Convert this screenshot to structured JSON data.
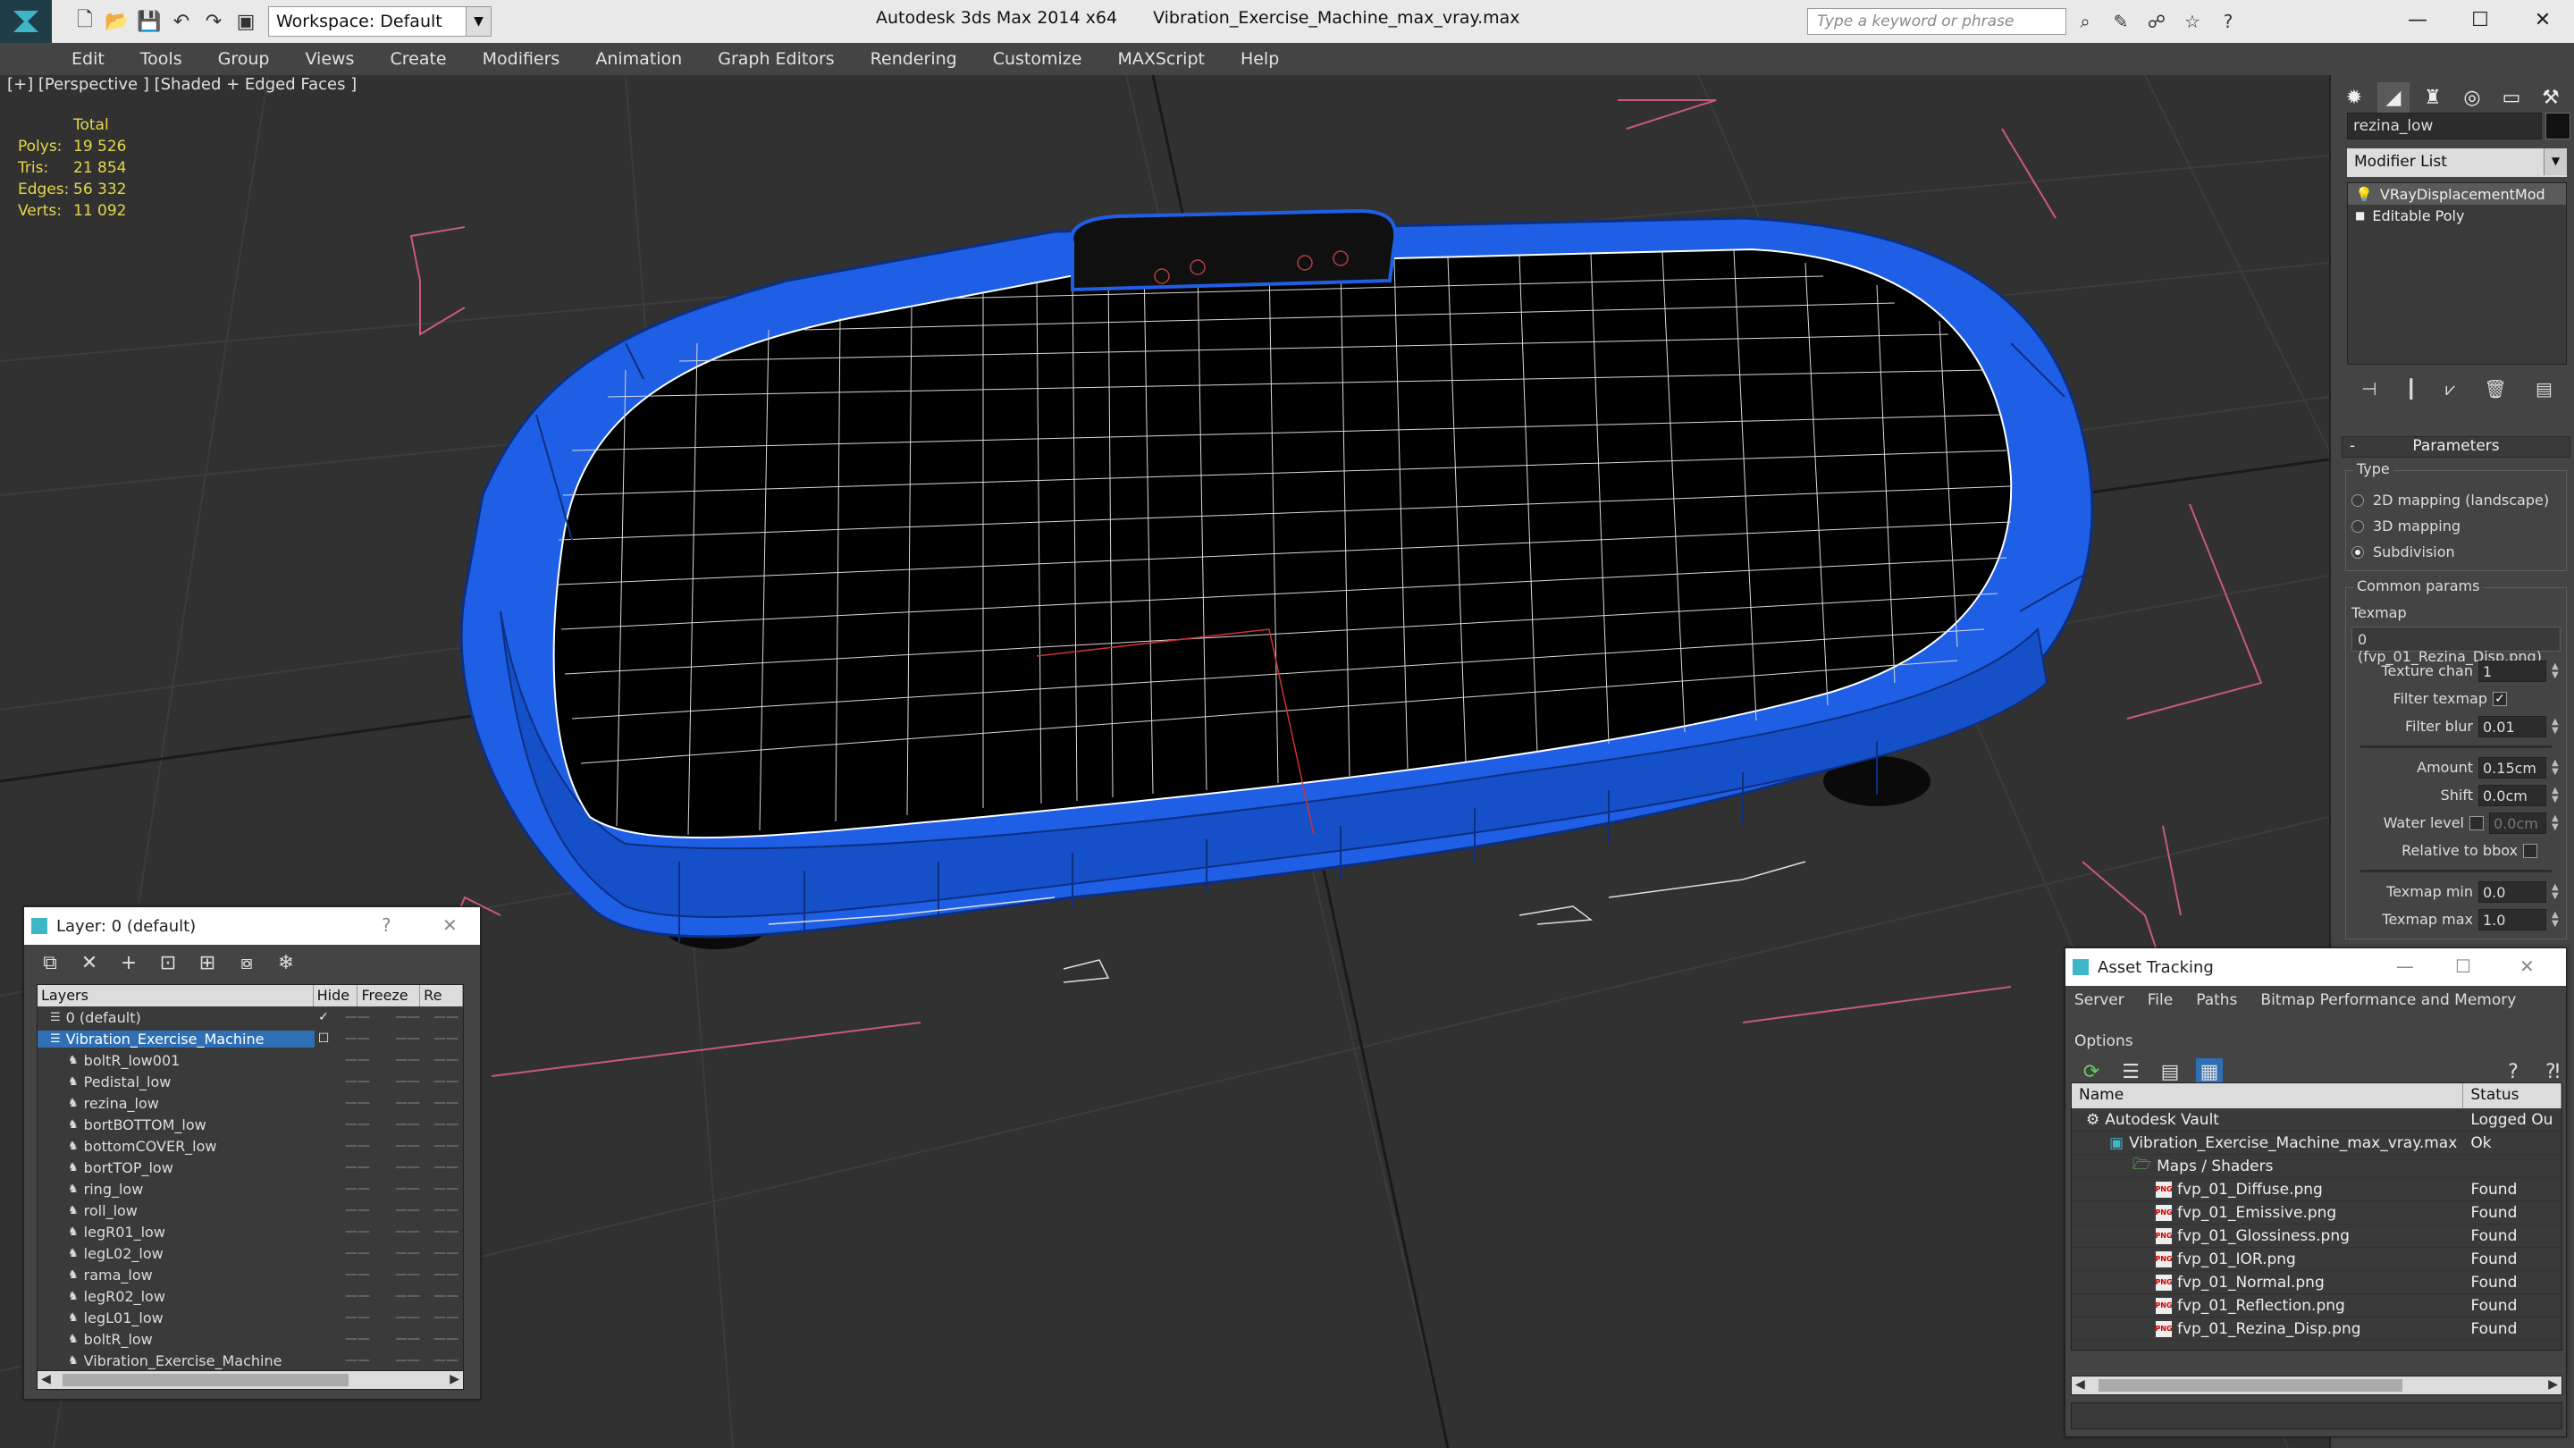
{
  "window": {
    "app_title": "Autodesk 3ds Max  2014 x64",
    "file_title": "Vibration_Exercise_Machine_max_vray.max",
    "workspace": "Workspace: Default",
    "search_placeholder": "Type a keyword or phrase"
  },
  "menu": [
    "Edit",
    "Tools",
    "Group",
    "Views",
    "Create",
    "Modifiers",
    "Animation",
    "Graph Editors",
    "Rendering",
    "Customize",
    "MAXScript",
    "Help"
  ],
  "viewport": {
    "label": "[+] [Perspective ] [Shaded + Edged Faces ]",
    "stats": {
      "total_label": "Total",
      "rows": [
        {
          "label": "Polys:",
          "value": "19 526"
        },
        {
          "label": "Tris:",
          "value": "21 854"
        },
        {
          "label": "Edges:",
          "value": "56 332"
        },
        {
          "label": "Verts:",
          "value": "11 092"
        }
      ]
    },
    "model_color": "#1e5ee8",
    "bbox_color": "#c85a7a"
  },
  "command_panel": {
    "object_name": "rezina_low",
    "modifier_list": "Modifier List",
    "stack": [
      "VRayDisplacementMod",
      "Editable Poly"
    ],
    "params_title": "Parameters",
    "type_group": "Type",
    "type_options": [
      {
        "label": "2D mapping (landscape)",
        "on": false
      },
      {
        "label": "3D mapping",
        "on": false
      },
      {
        "label": "Subdivision",
        "on": true
      }
    ],
    "common_group": "Common params",
    "texmap_label": "Texmap",
    "texmap_value": "0 (fvp_01_Rezina_Disp.png)",
    "texture_chan_label": "Texture chan",
    "texture_chan": "1",
    "filter_texmap_label": "Filter texmap",
    "filter_blur_label": "Filter blur",
    "filter_blur": "0.01",
    "amount_label": "Amount",
    "amount": "0.15cm",
    "shift_label": "Shift",
    "shift": "0.0cm",
    "water_level_label": "Water level",
    "water_level": "0.0cm",
    "relative_bbox_label": "Relative to bbox",
    "texmap_min_label": "Texmap min",
    "texmap_min": "0.0",
    "texmap_max_label": "Texmap max",
    "texmap_max": "1.0"
  },
  "layer_window": {
    "title": "Layer: 0 (default)",
    "help": "?",
    "columns": [
      "Layers",
      "Hide",
      "Freeze",
      "Re"
    ],
    "rows": [
      {
        "name": "0 (default)",
        "level": 0,
        "check": true
      },
      {
        "name": "Vibration_Exercise_Machine",
        "level": 0,
        "selected": true
      },
      {
        "name": "boltR_low001",
        "level": 1
      },
      {
        "name": "Pedistal_low",
        "level": 1
      },
      {
        "name": "rezina_low",
        "level": 1
      },
      {
        "name": "bortBOTTOM_low",
        "level": 1
      },
      {
        "name": "bottomCOVER_low",
        "level": 1
      },
      {
        "name": "bortTOP_low",
        "level": 1
      },
      {
        "name": "ring_low",
        "level": 1
      },
      {
        "name": "roll_low",
        "level": 1
      },
      {
        "name": "legR01_low",
        "level": 1
      },
      {
        "name": "legL02_low",
        "level": 1
      },
      {
        "name": "rama_low",
        "level": 1
      },
      {
        "name": "legR02_low",
        "level": 1
      },
      {
        "name": "legL01_low",
        "level": 1
      },
      {
        "name": "boltR_low",
        "level": 1
      },
      {
        "name": "Vibration_Exercise_Machine",
        "level": 1
      }
    ]
  },
  "asset_window": {
    "title": "Asset Tracking",
    "menu": [
      "Server",
      "File",
      "Paths",
      "Bitmap Performance and Memory",
      "Options"
    ],
    "columns": [
      "Name",
      "Status"
    ],
    "rows": [
      {
        "name": "Autodesk Vault",
        "status": "Logged Ou",
        "level": 0,
        "icon": "vault"
      },
      {
        "name": "Vibration_Exercise_Machine_max_vray.max",
        "status": "Ok",
        "level": 1,
        "icon": "max"
      },
      {
        "name": "Maps / Shaders",
        "status": "",
        "level": 2,
        "icon": "folder"
      },
      {
        "name": "fvp_01_Diffuse.png",
        "status": "Found",
        "level": 3,
        "icon": "png"
      },
      {
        "name": "fvp_01_Emissive.png",
        "status": "Found",
        "level": 3,
        "icon": "png"
      },
      {
        "name": "fvp_01_Glossiness.png",
        "status": "Found",
        "level": 3,
        "icon": "png"
      },
      {
        "name": "fvp_01_IOR.png",
        "status": "Found",
        "level": 3,
        "icon": "png"
      },
      {
        "name": "fvp_01_Normal.png",
        "status": "Found",
        "level": 3,
        "icon": "png"
      },
      {
        "name": "fvp_01_Reflection.png",
        "status": "Found",
        "level": 3,
        "icon": "png"
      },
      {
        "name": "fvp_01_Rezina_Disp.png",
        "status": "Found",
        "level": 3,
        "icon": "png"
      }
    ]
  }
}
